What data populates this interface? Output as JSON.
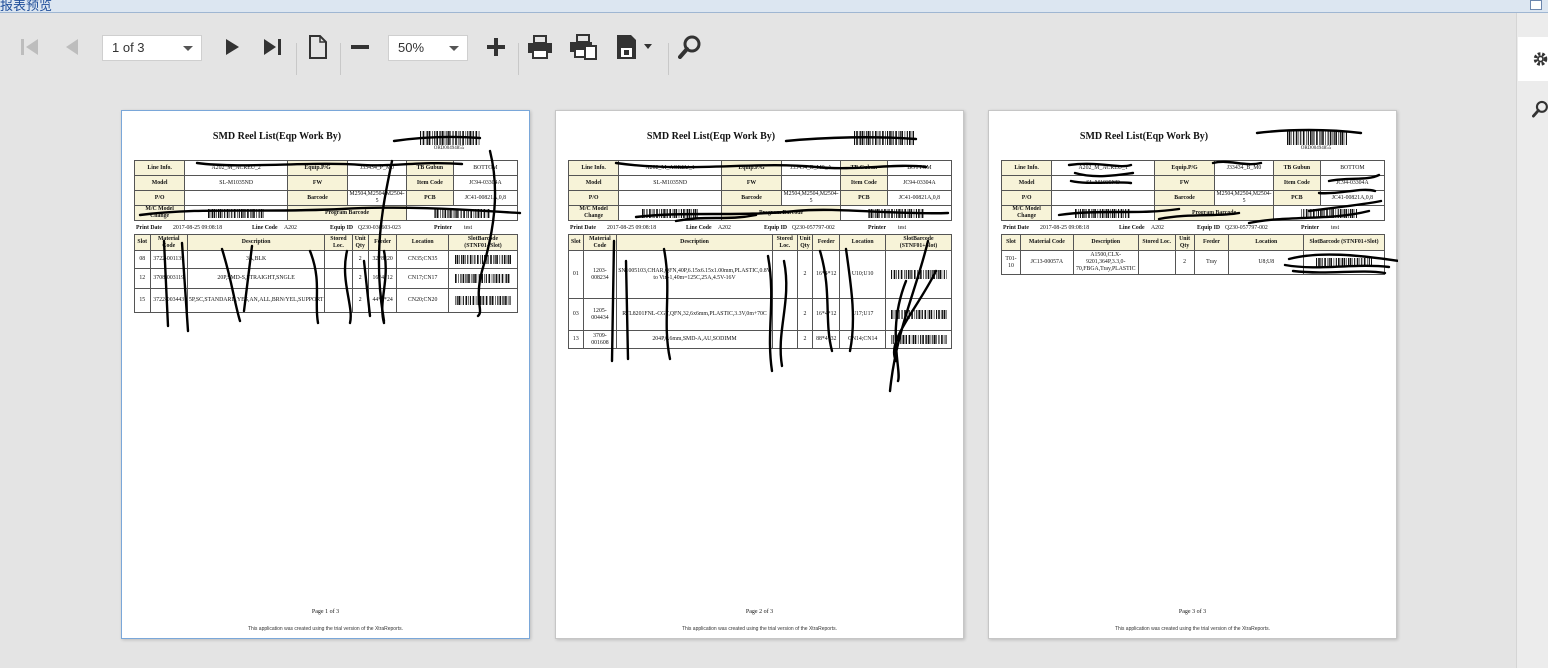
{
  "window": {
    "title": "报表预览"
  },
  "toolbar": {
    "page_selector": {
      "value": "1 of 3"
    },
    "zoom": {
      "value": "50%"
    },
    "icons": [
      "first-page-icon",
      "previous-page-icon",
      "next-page-icon",
      "last-page-icon",
      "page-setup-icon",
      "zoom-out-icon",
      "zoom-in-icon",
      "print-icon",
      "quick-print-icon",
      "export-icon",
      "search-icon"
    ]
  },
  "sidebar": {
    "icons": [
      "gear-icon",
      "search-icon"
    ]
  },
  "report": {
    "title": "SMD Reel List(Eqp Work By)",
    "labels": {
      "line_info": "Line Info.",
      "equip_pg": "Equip.P/G",
      "tb_gubun": "TB Gubun",
      "model": "Model",
      "fw": "FW",
      "item_code": "Item Code",
      "po": "P/O",
      "barcode": "Barcode",
      "pcb": "PCB",
      "mc_model_change": "M/C Model Change",
      "program_barcode": "Program Barcode",
      "print_date": "Print Date",
      "line_code": "Line Code",
      "equip_id": "Equip ID",
      "printer": "Printer"
    },
    "columns": [
      "Slot",
      "Material Code",
      "Description",
      "Stored Loc.",
      "Unit Qty",
      "Feeder",
      "Location",
      "SlotBarcode (STNF01+Slot)"
    ],
    "trial_note": "This application was created using the trial version of the XtraReports."
  },
  "pages": [
    {
      "barcode_text": "ORD00494855",
      "line_info": "A202_M_ACREU_2",
      "equip_pg": "J33434_P_M0",
      "tb_gubun": "BOTTOM",
      "model": "SL-M1035ND",
      "fw": "",
      "item_code": "JC94-03304A",
      "po": "",
      "barcode": "M2504,M2504,M2504-5",
      "pcb": "JC41-00821A,0,8",
      "print_date": "2017-08-25 09:08:18",
      "line_code": "A202",
      "equip_id": "Q230-030603-023",
      "printer": "test",
      "rows": [
        {
          "slot": "08",
          "code": "3722-001139",
          "desc": "3A,BLK",
          "stored": "",
          "qty": "2",
          "feeder": "32*8*20",
          "location": "CN35;CN35"
        },
        {
          "slot": "12",
          "code": "3708-003119",
          "desc": "20P,SMD-S,STRAIGHT,SNGLE",
          "stored": "",
          "qty": "2",
          "feeder": "16*4*12",
          "location": "CN17;CN17"
        },
        {
          "slot": "15",
          "code": "3722-003443",
          "desc": "5P,SC,STANDARD,YES,AN,ALL,BRN/YEL,SUPPORT",
          "stored": "",
          "qty": "2",
          "feeder": "44*4*24",
          "location": "CN20;CN20"
        }
      ],
      "page_number": "Page 1 of 3"
    },
    {
      "barcode_text": "",
      "line_info": "A202_M_ACREU_1",
      "equip_pg": "J33434_B_M0_A",
      "tb_gubun": "BOTTOM",
      "model": "SL-M1035ND",
      "fw": "",
      "item_code": "JC94-03304A",
      "po": "",
      "barcode": "M2504,M2504,M2504-5",
      "pcb": "JC41-00821A,0,8",
      "print_date": "2017-08-25 09:08:18",
      "line_code": "A202",
      "equip_id": "Q230-057797-002",
      "printer": "test",
      "rows": [
        {
          "slot": "01",
          "code": "1203-008234",
          "desc": "SN1005103,CHAR,QFN,40P,6.15x6.15x1.00mm,PLASTIC,0.8V to Vin-1,40m=125C,25A,4.5V-16V",
          "stored": "",
          "qty": "2",
          "feeder": "16*4*12",
          "location": "U10;U10"
        },
        {
          "slot": "03",
          "code": "1205-004434",
          "desc": "RTL8201FNL-CGT,QFN,32,6x6mm,PLASTIC,3.3V,0m+70C",
          "stored": "",
          "qty": "2",
          "feeder": "16*4*12",
          "location": "U17;U17"
        },
        {
          "slot": "13",
          "code": "3709-001608",
          "desc": "204P,0.6mm,SMD-A,AU,SODIMM",
          "stored": "",
          "qty": "2",
          "feeder": "88*4*32",
          "location": "CN14;CN14"
        }
      ],
      "page_number": "Page 2 of 3"
    },
    {
      "barcode_text": "ORD00494855",
      "line_info": "A202_M_ACREU_1",
      "equip_pg": "J33434_B_M0",
      "tb_gubun": "BOTTOM",
      "model": "SL-M1035ND",
      "fw": "",
      "item_code": "JC94-03304A",
      "po": "",
      "barcode": "M2504,M2504,M2504-5",
      "pcb": "JC41-00821A,0,8",
      "print_date": "2017-08-25 09:08:18",
      "line_code": "A202",
      "equip_id": "Q230-057797-002",
      "printer": "test",
      "rows": [
        {
          "slot": "T01-10",
          "code": "JC13-00057A",
          "desc": "A1500,CLX-9201,364P,3.3,0-70,FBGA,Tray,PLASTIC",
          "stored": "",
          "qty": "2",
          "feeder": "Tray",
          "location": "U8;U8"
        }
      ],
      "page_number": "Page 3 of 3"
    }
  ]
}
